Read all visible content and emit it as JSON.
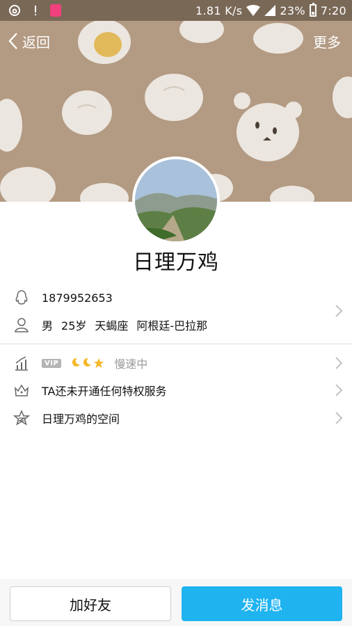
{
  "status_bar": {
    "speed": "1.81 K/s",
    "battery": "23%",
    "time": "7:20",
    "icons": [
      "netease-icon",
      "alert-icon",
      "shopping-bag-icon",
      "wifi-icon",
      "signal-icon",
      "battery-icon"
    ]
  },
  "header": {
    "back_label": "返回",
    "more_label": "更多"
  },
  "profile": {
    "name": "日理万鸡",
    "qq_number": "1879952653",
    "gender": "男",
    "age": "25岁",
    "zodiac": "天蝎座",
    "location": "阿根廷-巴拉那"
  },
  "level_row": {
    "vip_badge": "VIP",
    "status": "慢速中"
  },
  "privilege_row": {
    "label": "TA还未开通任何特权服务"
  },
  "space_row": {
    "label": "日理万鸡的空间"
  },
  "actions": {
    "add_friend": "加好友",
    "send_message": "发消息"
  },
  "colors": {
    "accent": "#1fb3f0",
    "cover_bg": "#b39a82",
    "bun": "#ebe6df"
  }
}
